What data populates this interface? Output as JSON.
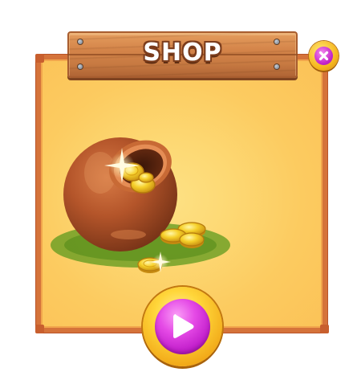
{
  "header": {
    "title": "SHOP"
  },
  "icons": {
    "close": "close-icon",
    "play": "play-icon",
    "illustration": "pot-of-gold-coins"
  },
  "colors": {
    "panel_fill": "#fcc65a",
    "panel_border": "#d5733a",
    "plank_wood": "#d48449",
    "button_gold": "#f6b81e",
    "button_magenta": "#c323c8",
    "pot_clay": "#b8582a",
    "coin_gold": "#f4c720"
  }
}
